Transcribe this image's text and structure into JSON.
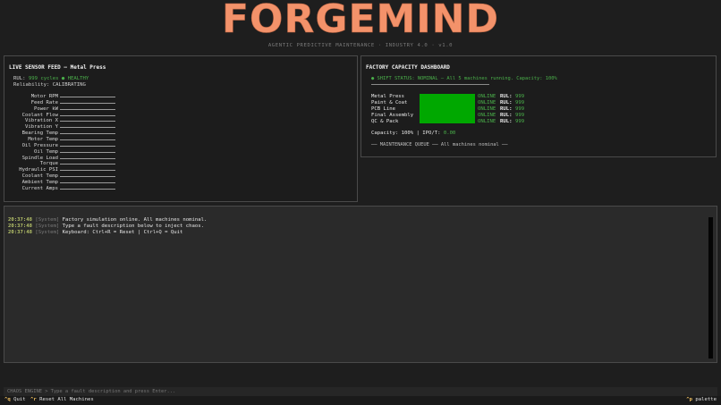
{
  "app": {
    "logo_text": "FORGEMIND",
    "subtitle": "AGENTIC PREDICTIVE MAINTENANCE · INDUSTRY 4.0 · v1.0"
  },
  "sensor_panel": {
    "title": "LIVE SENSOR FEED — Metal Press",
    "rul_label": "RUL:",
    "rul_value": "999 cycles ● HEALTHY",
    "reliability_label": "Reliability:",
    "reliability_value": "CALIBRATING",
    "sensors": [
      {
        "label": "Motor RPM"
      },
      {
        "label": "Feed Rate"
      },
      {
        "label": "Power kW"
      },
      {
        "label": "Coolant Flow"
      },
      {
        "label": "Vibration X"
      },
      {
        "label": "Vibration Y"
      },
      {
        "label": "Bearing Temp"
      },
      {
        "label": "Motor Temp"
      },
      {
        "label": "Oil Pressure"
      },
      {
        "label": "Oil Temp"
      },
      {
        "label": "Spindle Load"
      },
      {
        "label": "Torque"
      },
      {
        "label": "Hydraulic PSI"
      },
      {
        "label": "Coolant Temp"
      },
      {
        "label": "Ambient Temp"
      },
      {
        "label": "Current Amps"
      }
    ]
  },
  "capacity_panel": {
    "title": "FACTORY CAPACITY DASHBOARD",
    "shift_status": "● SHIFT STATUS: NOMINAL  —  All 5 machines running. Capacity: 100%",
    "machines": [
      {
        "name": "Metal Press",
        "status": "ONLINE",
        "rul_label": "RUL:",
        "rul": "999"
      },
      {
        "name": "Paint & Coat",
        "status": "ONLINE",
        "rul_label": "RUL:",
        "rul": "999"
      },
      {
        "name": "PCB Line",
        "status": "ONLINE",
        "rul_label": "RUL:",
        "rul": "999"
      },
      {
        "name": "Final Assembly",
        "status": "ONLINE",
        "rul_label": "RUL:",
        "rul": "999"
      },
      {
        "name": "QC & Pack",
        "status": "ONLINE",
        "rul_label": "RUL:",
        "rul": "999"
      }
    ],
    "capacity_text": "Capacity: 100% | IPO/T: ",
    "ipo_value": "0.00",
    "maintenance_queue": "── MAINTENANCE QUEUE ──  All machines nominal ──"
  },
  "log": {
    "lines": [
      {
        "time": "20:37:48",
        "source": "[System]",
        "message": "Factory simulation online. All machines nominal."
      },
      {
        "time": "20:37:48",
        "source": "[System]",
        "message": "Type a fault description below to inject chaos."
      },
      {
        "time": "20:37:48",
        "source": "[System]",
        "message": "Keyboard: Ctrl+R = Reset | Ctrl+Q = Quit"
      }
    ]
  },
  "input": {
    "placeholder": "CHAOS ENGINE > Type a fault description and press Enter..."
  },
  "footer": {
    "quit_key": "^q",
    "quit_label": "Quit",
    "reset_key": "^r",
    "reset_label": "Reset All Machines",
    "palette_key": "^p",
    "palette_label": "palette"
  },
  "colors": {
    "accent": "#f3926a",
    "healthy": "#4ab04a",
    "machine_block": "#00a800",
    "log_time": "#b7c46a",
    "footer_key": "#f0c060"
  }
}
